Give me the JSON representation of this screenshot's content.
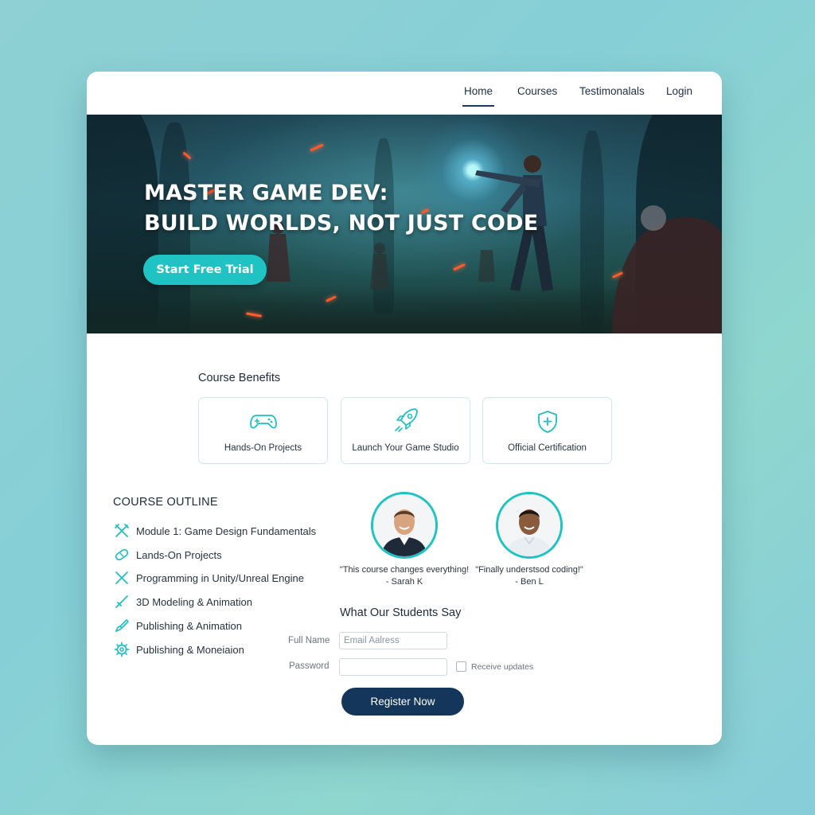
{
  "nav": {
    "items": [
      {
        "label": "Home",
        "active": true
      },
      {
        "label": "Courses",
        "active": false
      },
      {
        "label": "Testimonalals",
        "active": false
      },
      {
        "label": "Login",
        "active": false
      }
    ]
  },
  "hero": {
    "title_line1": "MASTER GAME DEV:",
    "title_line2": "BUILD WORLDS, NOT JUST CODE",
    "cta_label": "Start Free Trial"
  },
  "benefits": {
    "title": "Course Benefits",
    "items": [
      {
        "label": "Hands-On Projects",
        "icon": "gamepad-icon"
      },
      {
        "label": "Launch Your Game Studio",
        "icon": "rocket-icon"
      },
      {
        "label": "Official Certification",
        "icon": "shield-icon"
      }
    ]
  },
  "outline": {
    "title": "COURSE OUTLINE",
    "items": [
      {
        "label": "Module 1: Game Design Fundamentals",
        "icon": "crossed-tools-icon"
      },
      {
        "label": "Lands-On Projects",
        "icon": "bandage-icon"
      },
      {
        "label": "Programming in Unity/Unreal Engine",
        "icon": "crossed-swords-icon"
      },
      {
        "label": "3D Modeling & Animation",
        "icon": "sword-icon"
      },
      {
        "label": "Publishing & Animation",
        "icon": "brush-icon"
      },
      {
        "label": "Publishing & Moneiaion",
        "icon": "gear-icon"
      }
    ]
  },
  "testimonials": {
    "title": "What Our Students Say",
    "items": [
      {
        "quote": "\"This course changes everything!",
        "author": "- Sarah K"
      },
      {
        "quote": "\"Finally understsod coding!\"",
        "author": "- Ben L"
      }
    ]
  },
  "form": {
    "full_name_label": "Full Name",
    "email_placeholder": "Email Aalress",
    "password_label": "Password",
    "receive_updates_label": "Receive updates",
    "register_label": "Register Now"
  },
  "colors": {
    "accent": "#1fc3c4",
    "primary_dark": "#14365a",
    "nav_text": "#1f2f44"
  }
}
